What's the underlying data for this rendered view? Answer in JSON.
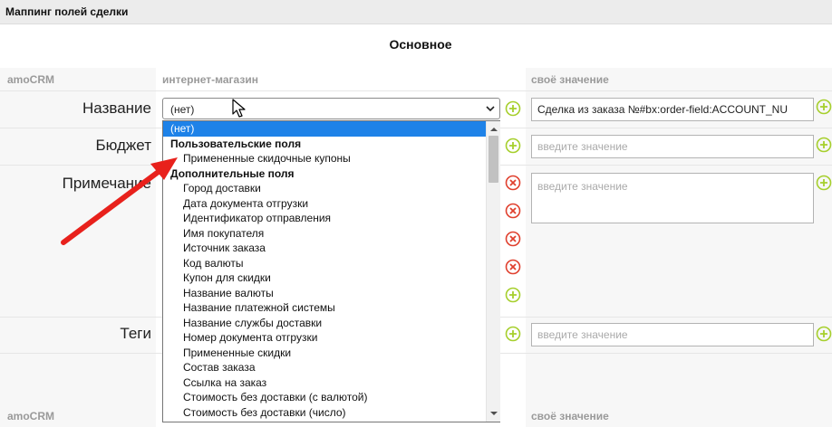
{
  "header": {
    "title": "Маппинг полей сделки"
  },
  "section": {
    "title": "Основное"
  },
  "columns": {
    "crm": "amoCRM",
    "shop": "интернет-магазин",
    "custom": "своё значение"
  },
  "footer_columns": {
    "crm": "amoCRM",
    "custom": "своё значение"
  },
  "fields": [
    {
      "label": "Название"
    },
    {
      "label": "Бюджет"
    },
    {
      "label": "Примечание"
    },
    {
      "label": "Теги"
    }
  ],
  "select": {
    "value": "(нет)"
  },
  "inputs": {
    "name_value": "Сделка из заказа №#bx:order-field:ACCOUNT_NU",
    "budget_placeholder": "введите значение",
    "note_placeholder": "введите значение",
    "tags_placeholder": "введите значение"
  },
  "dropdown": {
    "selected": "(нет)",
    "group1": "Пользовательские поля",
    "group1_options": [
      "Примененные скидочные купоны"
    ],
    "group2": "Дополнительные поля",
    "group2_options": [
      "Город доставки",
      "Дата документа отгрузки",
      "Идентификатор отправления",
      "Имя покупателя",
      "Источник заказа",
      "Код валюты",
      "Купон для скидки",
      "Название валюты",
      "Название платежной системы",
      "Название службы доставки",
      "Номер документа отгрузки",
      "Примененные скидки",
      "Состав заказа",
      "Ссылка на заказ",
      "Стоимость без доставки (с валютой)",
      "Стоимость без доставки (число)"
    ]
  },
  "icons": {
    "add": "plus-circle-icon",
    "remove": "remove-circle-icon",
    "expand": "chevron-down-icon",
    "pointer": "mouse-cursor-icon",
    "annotation": "red-arrow"
  },
  "colors": {
    "add": "#a6cf2c",
    "remove": "#e0402e",
    "selected": "#1e82e8",
    "arrow": "#e8211c"
  }
}
